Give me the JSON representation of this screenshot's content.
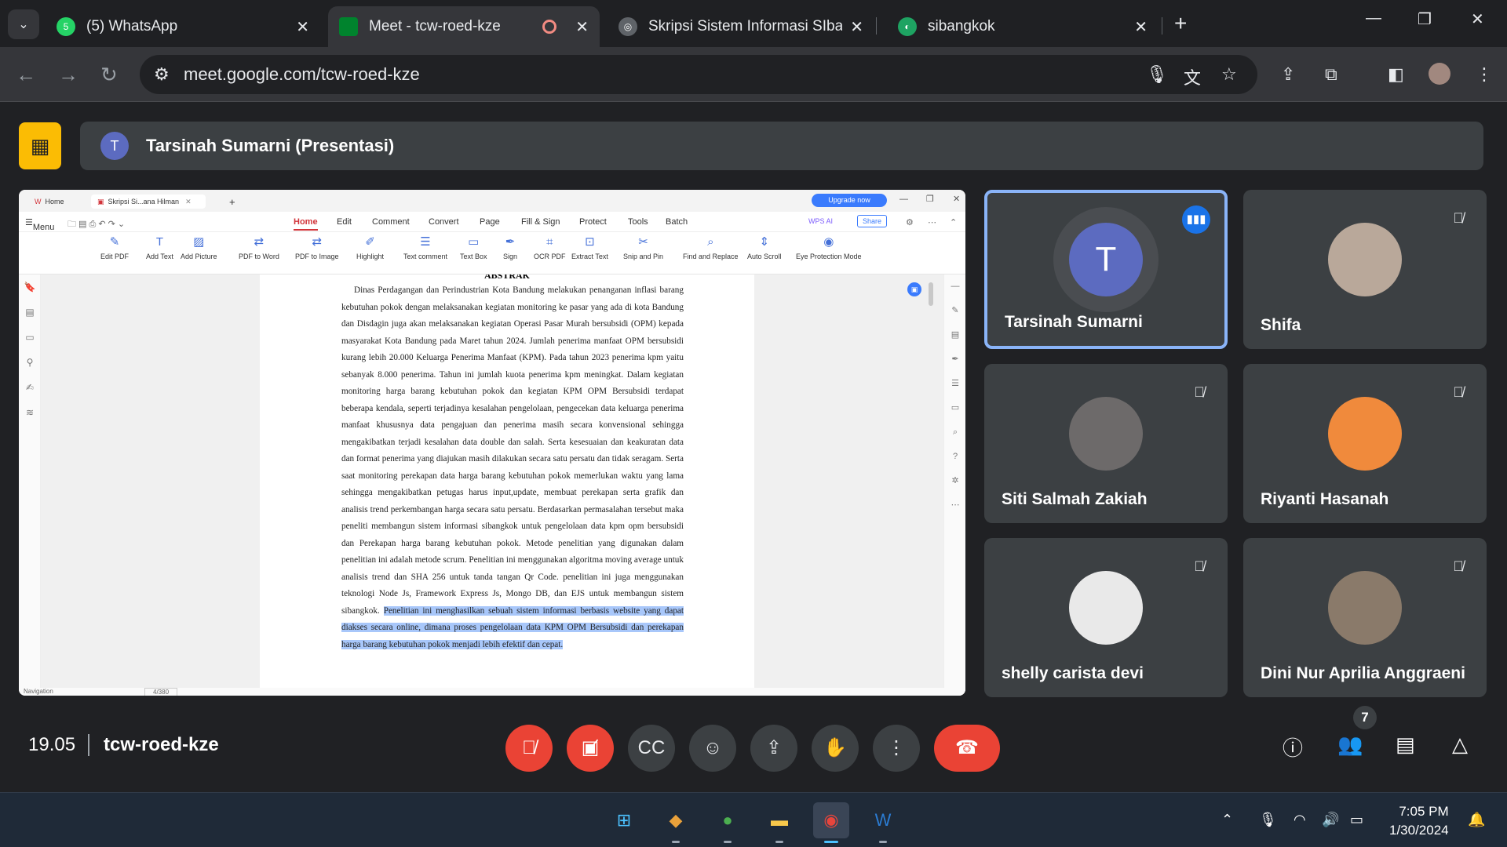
{
  "browser": {
    "tabs": [
      {
        "title": "(5) WhatsApp",
        "icon": "whatsapp-icon",
        "color": "#25d366",
        "badge": "5"
      },
      {
        "title": "Meet - tcw-roed-kze",
        "icon": "meet-icon",
        "color": "#00832d",
        "badge": ""
      },
      {
        "title": "Skripsi Sistem Informasi SIbang",
        "icon": "globe-icon",
        "color": "#5f6368",
        "badge": ""
      },
      {
        "title": "sibangkok",
        "icon": "site-icon",
        "color": "#1ea362",
        "badge": ""
      }
    ],
    "url": "meet.google.com/tcw-roed-kze"
  },
  "presentation": {
    "presenter_initial": "T",
    "label": "Tarsinah Sumarni (Presentasi)"
  },
  "wps": {
    "tabs": [
      "Home",
      "Skripsi Si...ana Hilman"
    ],
    "upgrade_label": "Upgrade now",
    "menu_label": "Menu",
    "menu": [
      "Home",
      "Edit",
      "Comment",
      "Convert",
      "Page",
      "Fill & Sign",
      "Protect",
      "Tools",
      "Batch"
    ],
    "wps_ai": "WPS AI",
    "share": "Share",
    "ribbon": [
      "Edit PDF",
      "Add Text",
      "Add Picture",
      "PDF to Word",
      "PDF to Image",
      "Highlight",
      "Text comment",
      "Text Box",
      "Sign",
      "OCR PDF",
      "Extract Text",
      "Snip and Pin",
      "Find and Replace",
      "Auto Scroll",
      "Eye Protection Mode"
    ],
    "status_nav": "Navigation",
    "status_page": "4/380"
  },
  "document": {
    "heading": "ABSTRAK",
    "paragraph_plain": "Dinas Perdagangan dan Perindustrian Kota Bandung melakukan penanganan inflasi barang kebutuhan pokok dengan melaksanakan kegiatan monitoring ke pasar yang ada di kota Bandung dan Disdagin juga akan melaksanakan kegiatan Operasi Pasar Murah bersubsidi (OPM) kepada masyarakat Kota Bandung pada Maret tahun 2024. Jumlah penerima manfaat OPM bersubsidi kurang lebih 20.000 Keluarga Penerima Manfaat (KPM). Pada tahun 2023 penerima kpm yaitu sebanyak 8.000 penerima. Tahun ini jumlah kuota penerima kpm meningkat. Dalam kegiatan monitoring harga barang kebutuhan pokok dan kegiatan KPM OPM Bersubsidi terdapat beberapa kendala, seperti terjadinya kesalahan pengelolaan, pengecekan data keluarga penerima manfaat khususnya data pengajuan dan penerima masih secara konvensional sehingga mengakibatkan terjadi kesalahan data double dan salah. Serta kesesuaian dan keakuratan data dan format penerima yang diajukan masih dilakukan secara satu persatu dan tidak seragam. Serta saat monitoring perekapan data harga barang kebutuhan pokok memerlukan waktu yang lama sehingga mengakibatkan petugas harus input,update, membuat perekapan serta grafik dan analisis trend perkembangan harga secara satu persatu. Berdasarkan permasalahan tersebut maka peneliti membangun sistem informasi sibangkok untuk pengelolaan data kpm opm bersubsidi dan Perekapan harga barang kebutuhan pokok. Metode penelitian yang digunakan dalam penelitian ini adalah metode scrum. Penelitian ini menggunakan algoritma moving average untuk analisis trend dan SHA 256 untuk tanda tangan Qr Code. penelitian ini juga menggunakan teknologi Node Js, Framework Express Js, Mongo DB, dan EJS untuk membangun sistem sibangkok. ",
    "paragraph_highlight": "Penelitian ini menghasilkan sebuah sistem informasi berbasis website yang dapat diakses secara online, dimana proses pengelolaan data KPM OPM Bersubsidi dan perekapan harga barang kebutuhan pokok menjadi lebih efektif dan cepat."
  },
  "participants": [
    {
      "name": "Tarsinah Sumarni",
      "initial": "T",
      "speaking": true,
      "avatar_color": "#5c6bc0"
    },
    {
      "name": "Shifa",
      "initial": "",
      "speaking": false,
      "avatar_color": "#b9a89a"
    },
    {
      "name": "Siti Salmah Zakiah",
      "initial": "",
      "speaking": false,
      "avatar_color": "#6d6a6a"
    },
    {
      "name": "Riyanti Hasanah",
      "initial": "",
      "speaking": false,
      "avatar_color": "#f08a3c"
    },
    {
      "name": "shelly carista devi",
      "initial": "",
      "speaking": false,
      "avatar_color": "#e9e9e9"
    },
    {
      "name": "Dini Nur Aprilia Anggraeni",
      "initial": "",
      "speaking": false,
      "avatar_color": "#8a7a6a"
    }
  ],
  "meet": {
    "time": "19.05",
    "code": "tcw-roed-kze",
    "people_count": "7",
    "colors": {
      "danger": "#ea4335",
      "control": "#3c4043",
      "speaking": "#8ab4f8"
    }
  },
  "taskbar": {
    "time": "7:05 PM",
    "date": "1/30/2024"
  }
}
